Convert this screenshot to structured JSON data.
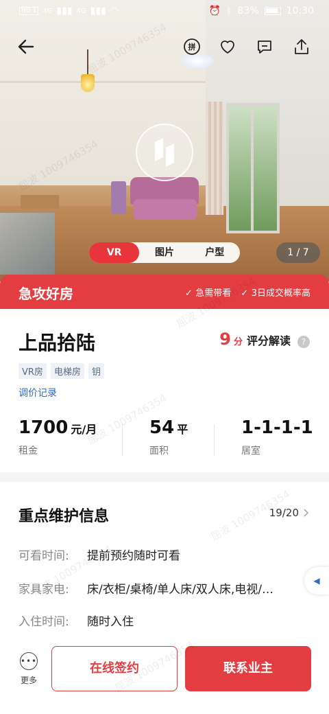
{
  "status_bar": {
    "sim1": "HD 1",
    "sim2": "HD 2",
    "signal1": "4G",
    "signal2": "4G",
    "battery": "83%",
    "time": "10:30"
  },
  "hero": {
    "tabs": [
      {
        "label": "VR",
        "active": true
      },
      {
        "label": "图片",
        "active": false
      },
      {
        "label": "户型",
        "active": false
      }
    ],
    "photo_counter": "1 / 7",
    "nav_icons": [
      "back-arrow-icon",
      "pinyin-icon",
      "heart-icon",
      "comment-icon",
      "share-icon"
    ],
    "nav_pin_glyph": "拼"
  },
  "urgent": {
    "title": "急攻好房",
    "tags": [
      "急需带看",
      "3日成交概率高"
    ]
  },
  "listing": {
    "title": "上品拾陆",
    "score": "9",
    "score_unit": "分",
    "score_text": "评分解读",
    "tags": [
      "VR房",
      "电梯房",
      "钥"
    ],
    "price_record": "调价记录",
    "stats": [
      {
        "value": "1700",
        "unit": "元/月",
        "label": "租金"
      },
      {
        "value": "54",
        "unit": "平",
        "label": "面积"
      },
      {
        "value": "1-1-1-1",
        "unit": "",
        "label": "居室"
      }
    ]
  },
  "maintenance": {
    "title": "重点维护信息",
    "count": "19/20",
    "rows": [
      {
        "key": "可看时间:",
        "value": "提前预约随时可看"
      },
      {
        "key": "家具家电:",
        "value": "床/衣柜/桌椅/单人床/双人床,电视/…"
      },
      {
        "key": "入住时间:",
        "value": "随时入住"
      }
    ]
  },
  "bottom_bar": {
    "more_label": "更多",
    "sign_label": "在线签约",
    "contact_label": "联系业主"
  },
  "watermark": "屈波 1009746354",
  "colors": {
    "accent": "#e33d41",
    "link": "#2f6cc3"
  }
}
